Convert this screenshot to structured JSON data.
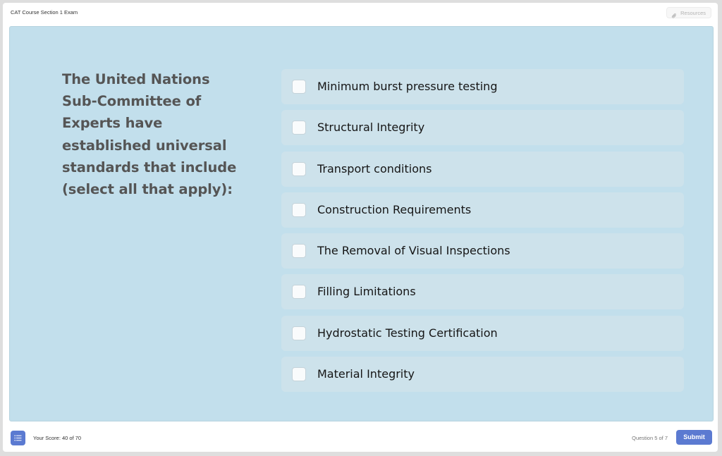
{
  "header": {
    "course_title": "CAT Course Section 1 Exam",
    "resources_label": "Resources",
    "resources_icon": "paperclip-icon"
  },
  "question": {
    "text": "The United Nations Sub-Committee of Experts have established universal standards that include (select all that apply):",
    "options": [
      {
        "label": "Minimum burst pressure testing",
        "checked": false
      },
      {
        "label": "Structural Integrity",
        "checked": false
      },
      {
        "label": "Transport conditions",
        "checked": false
      },
      {
        "label": "Construction Requirements",
        "checked": false
      },
      {
        "label": "The Removal of Visual Inspections",
        "checked": false
      },
      {
        "label": "Filling Limitations",
        "checked": false
      },
      {
        "label": "Hydrostatic Testing Certification",
        "checked": false
      },
      {
        "label": "Material Integrity",
        "checked": false
      }
    ]
  },
  "footer": {
    "menu_icon": "list-menu-icon",
    "score": "Your Score: 40 of 70",
    "question_count": "Question 5 of 7",
    "submit_label": "Submit"
  },
  "colors": {
    "slide_background": "#c2dfec",
    "option_background": "#cde2eb",
    "accent": "#5b7ad1"
  }
}
